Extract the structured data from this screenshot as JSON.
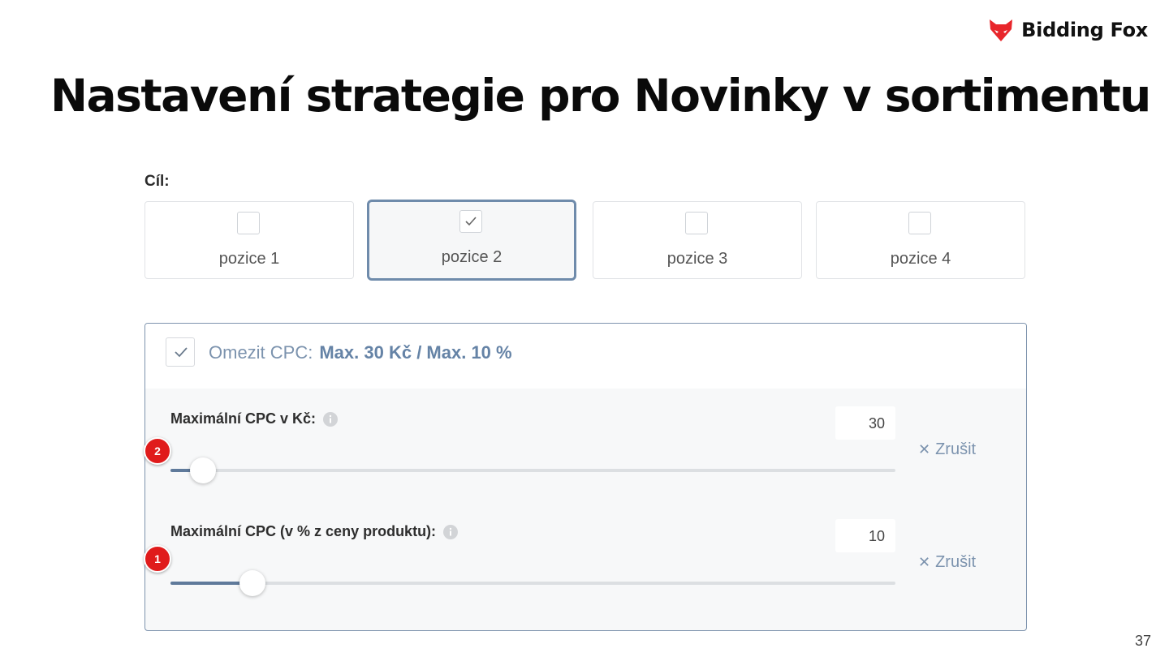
{
  "brand": {
    "name": "Bidding Fox",
    "icon": "fox-head-icon",
    "color": "#e8262b"
  },
  "title": "Nastavení strategie pro Novinky v sortimentu",
  "goal": {
    "label": "Cíl:",
    "options": [
      {
        "label": "pozice 1",
        "selected": false
      },
      {
        "label": "pozice 2",
        "selected": true
      },
      {
        "label": "pozice 3",
        "selected": false
      },
      {
        "label": "pozice 4",
        "selected": false
      }
    ]
  },
  "limit": {
    "checked": true,
    "label": "Omezit CPC:",
    "summary": "Max. 30 Kč / Max. 10 %",
    "fields": [
      {
        "label": "Maximální CPC v Kč:",
        "value": "30",
        "cancel": "Zrušit",
        "slider_percent": 4.5,
        "badge": "2"
      },
      {
        "label": "Maximální CPC (v % z ceny produktu):",
        "value": "10",
        "cancel": "Zrušit",
        "slider_percent": 11.3,
        "badge": "1"
      }
    ]
  },
  "colors": {
    "accent": "#6f8bab",
    "badge": "#e01b1b"
  },
  "page_number": "37"
}
